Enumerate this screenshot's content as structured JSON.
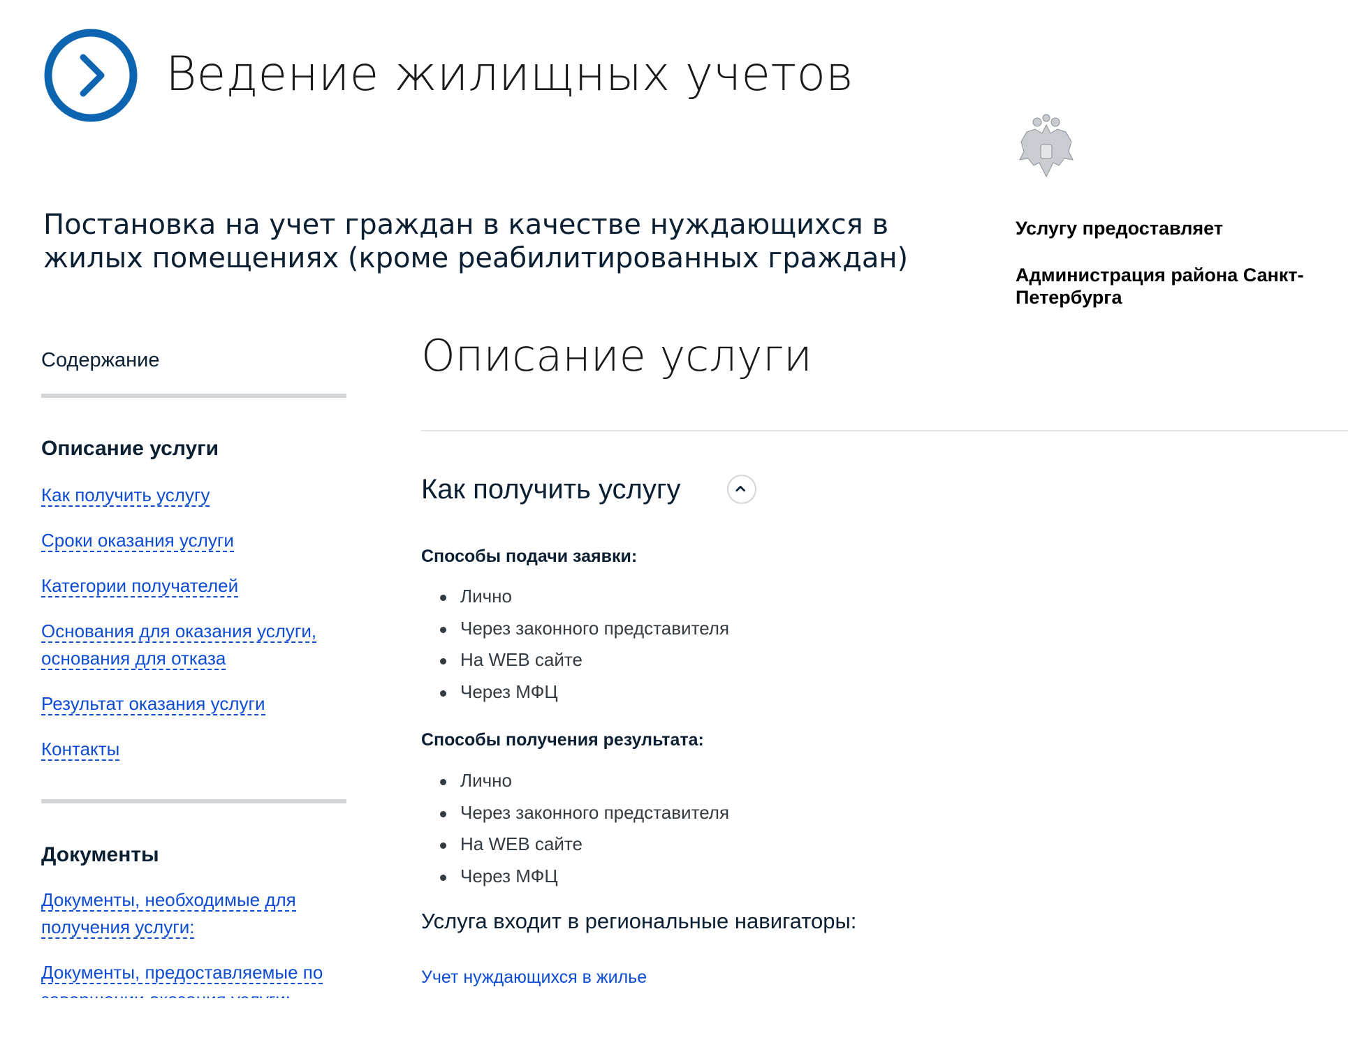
{
  "header": {
    "title": "Ведение жилищных учетов",
    "logo_icon": "chevron-right-circle-icon",
    "accent_color": "#0d64b0"
  },
  "service": {
    "title": "Постановка на учет граждан в качестве нуждающихся в жилых помещениях (кроме реабилитированных граждан)"
  },
  "provider": {
    "label": "Услугу предоставляет",
    "name": "Администрация района Санкт-Петербурга",
    "emblem_icon": "coat-of-arms-icon"
  },
  "sidebar": {
    "title": "Содержание",
    "sections": [
      {
        "title": "Описание услуги",
        "items": [
          {
            "label": "Как получить услугу"
          },
          {
            "label": "Сроки оказания услуги"
          },
          {
            "label": "Категории получателей"
          },
          {
            "label": "Основания для оказания услуги, основания для отказа"
          },
          {
            "label": "Результат оказания услуги"
          },
          {
            "label": "Контакты"
          }
        ]
      },
      {
        "title": "Документы",
        "items": [
          {
            "label": "Документы, необходимые для получения услуги:"
          },
          {
            "label": "Документы, предоставляемые по завершении оказания услуги:"
          }
        ]
      }
    ]
  },
  "main": {
    "heading": "Описание услуги",
    "how_to": {
      "title": "Как получить услугу",
      "toggle_icon": "chevron-up-icon",
      "submit_methods": {
        "title": "Способы подачи заявки:",
        "items": [
          "Лично",
          "Через законного представителя",
          "На WEB сайте",
          "Через МФЦ"
        ]
      },
      "result_methods": {
        "title": "Способы получения результата:",
        "items": [
          "Лично",
          "Через законного представителя",
          "На WEB сайте",
          "Через МФЦ"
        ]
      },
      "navigators": {
        "title": "Услуга входит в региональные навигаторы:",
        "link": "Учет нуждающихся в жилье"
      }
    }
  },
  "colors": {
    "link": "#0d4cd3",
    "text": "#0b1f33",
    "divider": "#d3d6d9"
  }
}
